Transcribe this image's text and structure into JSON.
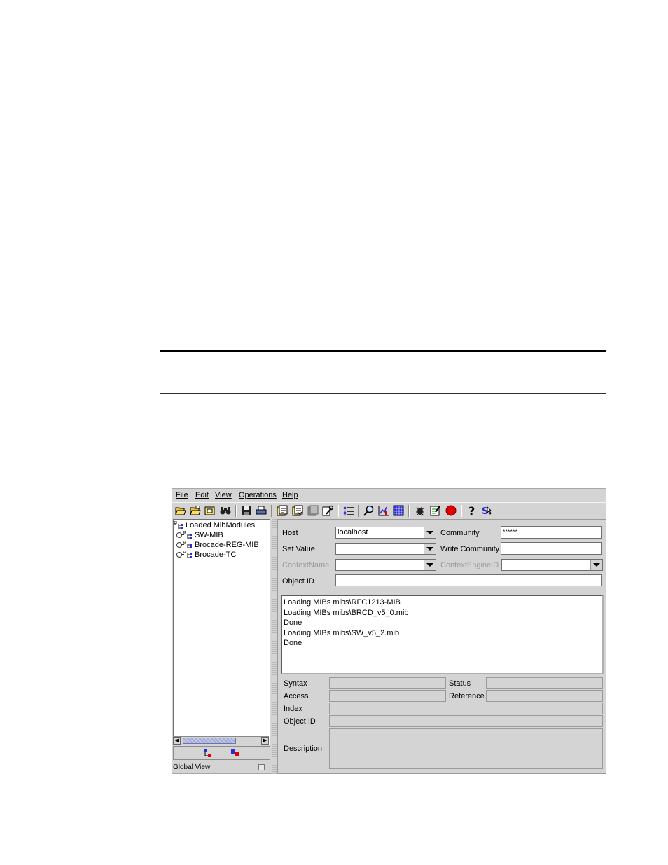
{
  "menubar": {
    "items": [
      {
        "label": "File"
      },
      {
        "label": "Edit"
      },
      {
        "label": "View"
      },
      {
        "label": "Operations"
      },
      {
        "label": "Help"
      }
    ]
  },
  "tree": {
    "root": "Loaded MibModules",
    "children": [
      "SW-MIB",
      "Brocade-REG-MIB",
      "Brocade-TC"
    ]
  },
  "footer": {
    "global_view": "Global View"
  },
  "form": {
    "host_label": "Host",
    "host_value": "localhost",
    "community_label": "Community",
    "community_value": "******",
    "set_value_label": "Set Value",
    "set_value_value": "",
    "write_community_label": "Write Community",
    "write_community_value": "",
    "context_name_label": "ContextName",
    "context_engine_label": "ContextEngineID",
    "object_id_label": "Object ID",
    "object_id_value": ""
  },
  "log": {
    "lines": [
      "Loading MIBs mibs\\RFC1213-MIB",
      "Loading MIBs mibs\\BRCD_v5_0.mib",
      "Done",
      "Loading MIBs mibs\\SW_v5_2.mib",
      "Done"
    ]
  },
  "details": {
    "syntax": "Syntax",
    "status": "Status",
    "access": "Access",
    "reference": "Reference",
    "index": "Index",
    "object_id": "Object ID",
    "description": "Description"
  },
  "colors": {
    "window_bg": "#d4d4d4",
    "stop_red": "#e00000",
    "accent_blue": "#2b2bd8"
  }
}
